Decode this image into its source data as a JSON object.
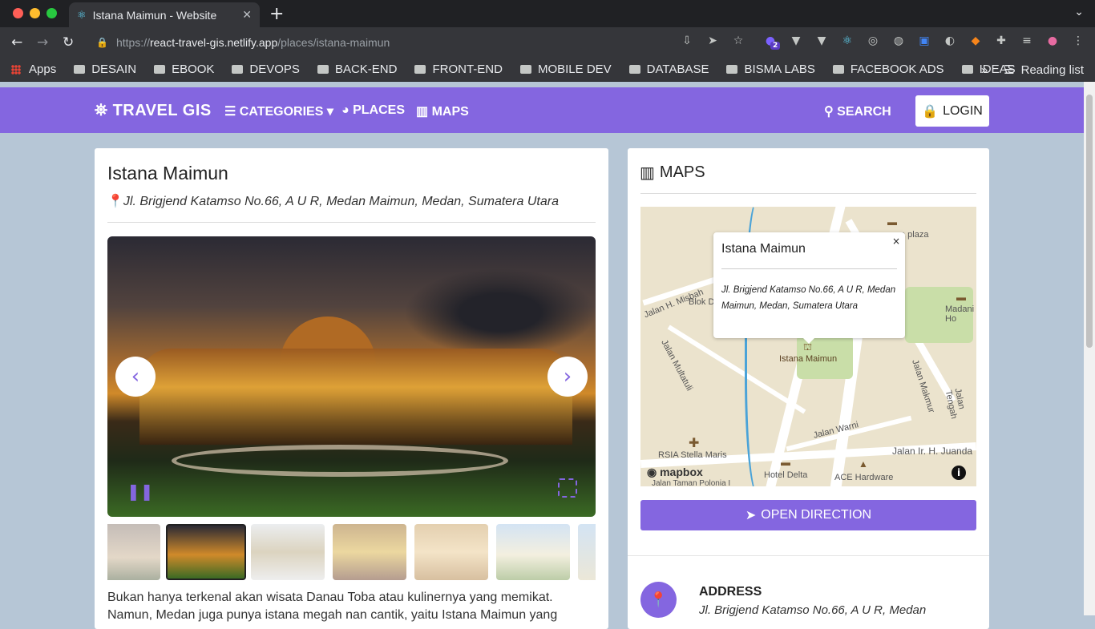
{
  "browser": {
    "tab_title": "Istana Maimun - Website",
    "url_prefix": "https://",
    "url_host": "react-travel-gis.netlify.app",
    "url_path": "/places/istana-maimun",
    "extension_badge": "2"
  },
  "bookmarks": {
    "items": [
      "Apps",
      "DESAIN",
      "EBOOK",
      "DEVOPS",
      "BACK-END",
      "FRONT-END",
      "MOBILE DEV",
      "DATABASE",
      "BISMA LABS",
      "FACEBOOK ADS",
      "IDEAS"
    ],
    "overflow": "»",
    "reading_list": "Reading list"
  },
  "navbar": {
    "brand": "TRAVEL GIS",
    "categories": "CATEGORIES",
    "places": "PLACES",
    "maps": "MAPS",
    "search": "SEARCH",
    "login": "LOGIN"
  },
  "place": {
    "name": "Istana Maimun",
    "address": "Jl. Brigjend Katamso No.66, A U R, Medan Maimun, Medan, Sumatera Utara",
    "description": "Bukan hanya terkenal akan wisata Danau Toba atau kulinernya yang memikat. Namun, Medan juga punya istana megah nan cantik, yaitu Istana Maimun yang"
  },
  "map_card": {
    "title": "MAPS",
    "popup_title": "Istana Maimun",
    "popup_close": "×",
    "popup_address": "Jl. Brigjend Katamso No.66, A U R, Medan Maimun, Medan, Sumatera Utara",
    "attribution": "mapbox",
    "labels": [
      "Istana Maimun",
      "Jalan H. Misbah",
      "Blok D",
      "Jalan Multatuli",
      "Jalan Makmur",
      "Jalan Tengah",
      "Jalan Warni",
      "Jalan Ir. H. Juanda",
      "RSIA Stella Maris",
      "Hotel Delta",
      "ACE Hardware",
      "Madani Ho",
      "a plaza",
      "Jalan Taman Polonia I"
    ],
    "direction_button": "OPEN DIRECTION",
    "address_label": "ADDRESS",
    "address_value": "Jl. Brigjend Katamso No.66, A U R, Medan"
  },
  "colors": {
    "accent": "#8466e0",
    "page_bg": "#b6c6d6"
  }
}
